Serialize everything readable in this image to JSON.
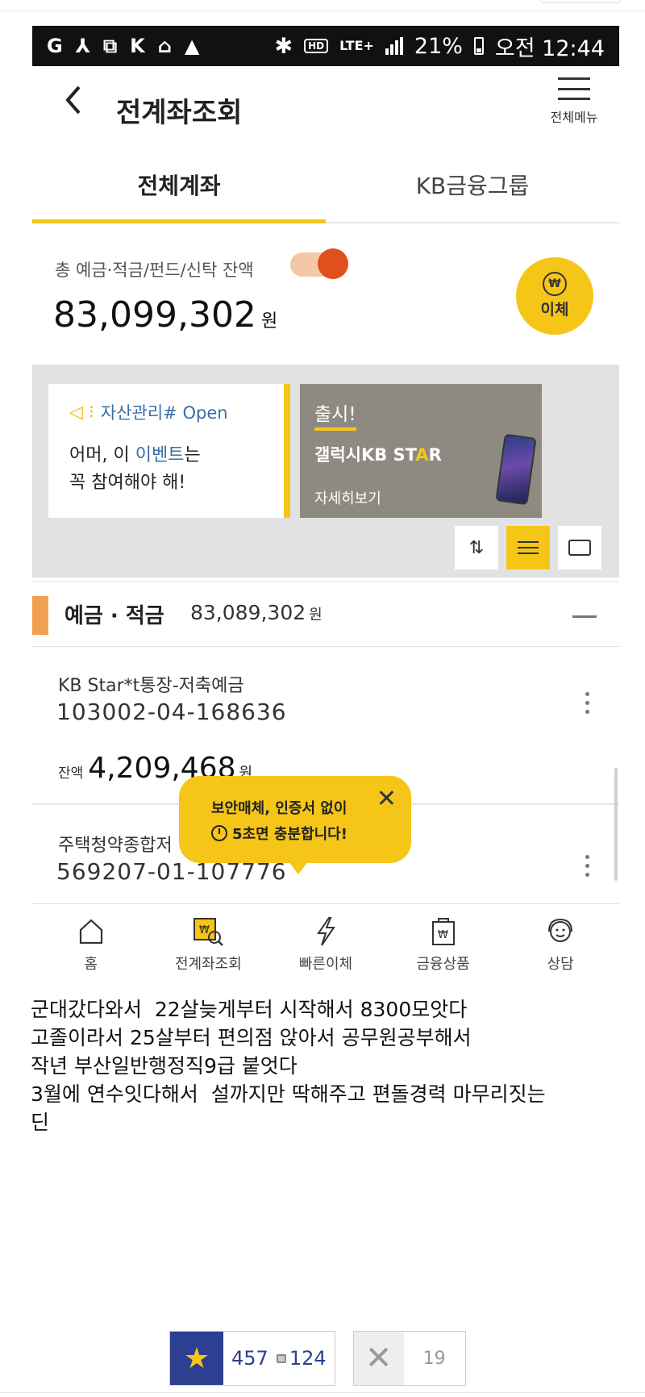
{
  "status": {
    "signal_label": "LTE+",
    "battery": "21%",
    "time": "오전 12:44",
    "hd": "HD"
  },
  "header": {
    "title": "전계좌조회",
    "menu_label": "전체메뉴"
  },
  "tabs": [
    {
      "label": "전체계좌",
      "active": true
    },
    {
      "label": "KB금융그룹",
      "active": false
    }
  ],
  "total": {
    "label": "총 예금·적금/펀드/신탁 잔액",
    "amount": "83,099,302",
    "unit": "원",
    "transfer_label": "이체"
  },
  "banner": {
    "card1": {
      "head": "자산관리# Open",
      "line1_pre": "어머, 이 ",
      "line1_hl": "이벤트",
      "line1_post": "는",
      "line2": "꼭 참여해야 해!"
    },
    "card2": {
      "launch": "출시!",
      "product_pre": "갤럭시KB ST",
      "product_star": "A",
      "product_post": "R",
      "more": "자세히보기"
    }
  },
  "section": {
    "name": "예금 · 적금",
    "amount": "83,089,302",
    "unit": "원"
  },
  "accounts": [
    {
      "name": "KB Star*t통장-저축예금",
      "number": "103002-04-168636",
      "balance_label": "잔액",
      "balance": "4,209,468",
      "unit": "원"
    },
    {
      "name": "주택청약종합저",
      "number": "569207-01-107776"
    }
  ],
  "tooltip": {
    "line1": "보안매체, 인증서 없이",
    "line2": "5초면 충분합니다!"
  },
  "bottom_nav": [
    {
      "label": "홈",
      "icon": "home-icon"
    },
    {
      "label": "전계좌조회",
      "icon": "account-search-icon"
    },
    {
      "label": "빠른이체",
      "icon": "lightning-icon"
    },
    {
      "label": "금융상품",
      "icon": "product-icon"
    },
    {
      "label": "상담",
      "icon": "headset-icon"
    }
  ],
  "post": {
    "lines": [
      "군대갔다와서  22살늦게부터 시작해서 8300모앗다",
      "고졸이라서 25살부터 편의점 앉아서 공무원공부해서",
      "작년 부산일반행정직9급 붙엇다",
      "3월에 연수잇다해서  설까지만 딱해주고 편돌경력 마무리짓는",
      "딘"
    ]
  },
  "votes": {
    "up_count": "457",
    "comment_count": "124",
    "down_count": "19"
  },
  "colors": {
    "accent": "#f5c518",
    "toggle": "#e04f1e",
    "section_bar": "#f0a050",
    "vote_blue": "#2c3f91",
    "link_blue": "#3a6ea5"
  }
}
